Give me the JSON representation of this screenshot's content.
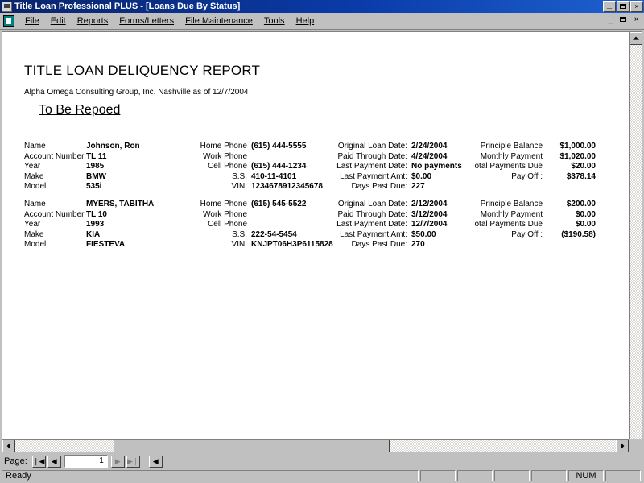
{
  "window": {
    "title": "Title Loan Professional PLUS - [Loans Due By Status]",
    "minimize_label": "_",
    "restore_label": "",
    "close_label": "×"
  },
  "menu": {
    "items": [
      {
        "label": "File"
      },
      {
        "label": "Edit"
      },
      {
        "label": "Reports"
      },
      {
        "label": "Forms/Letters"
      },
      {
        "label": "File Maintenance"
      },
      {
        "label": "Tools"
      },
      {
        "label": "Help"
      }
    ],
    "mdi_minimize": "_",
    "mdi_close": "×"
  },
  "report": {
    "title": "TITLE LOAN DELIQUENCY REPORT",
    "subtitle": "Alpha Omega Consulting Group, Inc. Nashville as of 12/7/2004",
    "section_heading": "To Be Repoed",
    "labels": {
      "name": "Name",
      "account_number": "Account Number",
      "year": "Year",
      "make": "Make",
      "model": "Model",
      "home_phone": "Home Phone",
      "work_phone": "Work Phone",
      "cell_phone": "Cell Phone",
      "ss": "S.S.",
      "vin": "VIN:",
      "original_loan_date": "Original Loan Date:",
      "paid_through_date": "Paid Through Date:",
      "last_payment_date": "Last Payment Date:",
      "last_payment_amt": "Last Payment Amt:",
      "days_past_due": "Days Past Due:",
      "principle_balance": "Principle Balance",
      "monthly_payment": "Monthly Payment",
      "total_payments_due": "Total Payments Due",
      "pay_off": "Pay Off :"
    },
    "records": [
      {
        "name": "Johnson, Ron",
        "account_number": "TL 11",
        "year": "1985",
        "make": "BMW",
        "model": "535i",
        "home_phone": "(615) 444-5555",
        "work_phone": "",
        "cell_phone": "(615) 444-1234",
        "ss": "410-11-4101",
        "vin": "1234678912345678",
        "original_loan_date": "2/24/2004",
        "paid_through_date": "4/24/2004",
        "last_payment_date": "No payments",
        "last_payment_amt": "$0.00",
        "days_past_due": "227",
        "principle_balance": "$1,000.00",
        "monthly_payment": "$1,020.00",
        "total_payments_due": "$20.00",
        "pay_off": "$378.14"
      },
      {
        "name": "MYERS, TABITHA",
        "account_number": "TL 10",
        "year": "1993",
        "make": "KIA",
        "model": "FIESTEVA",
        "home_phone": "(615) 545-5522",
        "work_phone": "",
        "cell_phone": "",
        "ss": "222-54-5454",
        "vin": "KNJPT06H3P6115828",
        "original_loan_date": "2/12/2004",
        "paid_through_date": "3/12/2004",
        "last_payment_date": "12/7/2004",
        "last_payment_amt": "$50.00",
        "days_past_due": "270",
        "principle_balance": "$200.00",
        "monthly_payment": "$0.00",
        "total_payments_due": "$0.00",
        "pay_off": "($190.58)"
      }
    ]
  },
  "page_bar": {
    "label": "Page:",
    "first_glyph": "❘◀",
    "prev_glyph": "◀",
    "next_glyph": "▶",
    "last_glyph": "▶❘",
    "close_preview_glyph": "◀",
    "value": "1"
  },
  "status_bar": {
    "message": "Ready",
    "caps": "",
    "num": "NUM",
    "scrl": ""
  },
  "colors": {
    "title_bar_start": "#0a246a",
    "title_bar_end": "#1e62d0",
    "face": "#c0c0c0",
    "page": "#ffffff",
    "text": "#000000"
  }
}
